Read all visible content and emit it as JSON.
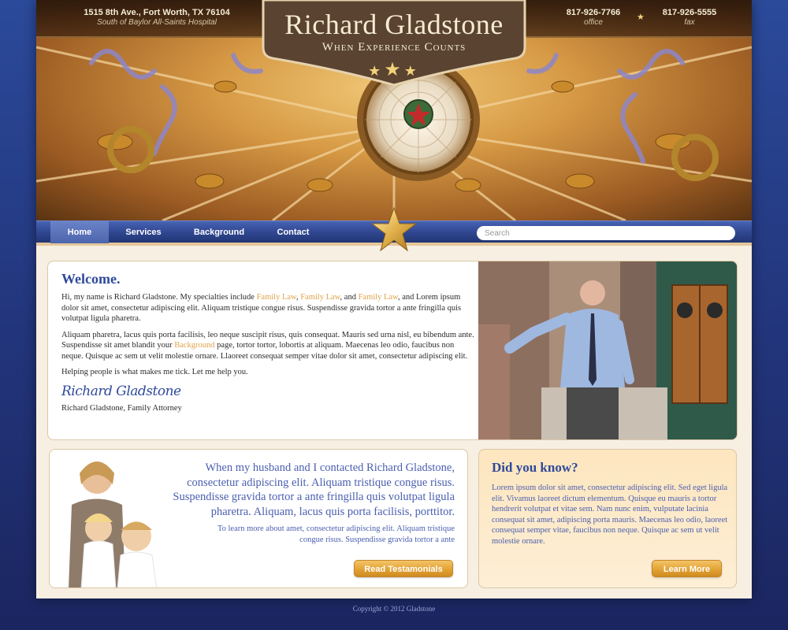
{
  "header": {
    "address_line1": "1515 8th Ave., Fort Worth, TX 76104",
    "address_line2": "South of Baylor All-Saints Hospital",
    "phone_office": "817-926-7766",
    "phone_office_label": "office",
    "phone_fax": "817-926-5555",
    "phone_fax_label": "fax",
    "logo_title": "Richard Gladstone",
    "logo_tagline": "When Experience Counts"
  },
  "nav": {
    "items": [
      {
        "label": "Home",
        "active": true
      },
      {
        "label": "Services",
        "active": false
      },
      {
        "label": "Background",
        "active": false
      },
      {
        "label": "Contact",
        "active": false
      }
    ],
    "search_placeholder": "Search"
  },
  "welcome": {
    "title": "Welcome.",
    "p1_before": "Hi, my name is Richard Gladstone. My specialties include ",
    "p1_link1": "Family Law",
    "p1_sep1": ", ",
    "p1_link2": "Family Law",
    "p1_sep2": ", and ",
    "p1_link3": "Family Law",
    "p1_after": ", and Lorem ipsum dolor sit amet, consectetur adipiscing elit. Aliquam tristique congue risus. Suspendisse gravida tortor a ante fringilla quis volutpat ligula pharetra.",
    "p2_before": "Aliquam pharetra, lacus quis porta facilisis, leo neque suscipit risus, quis consequat. Mauris sed urna nisl, eu bibendum ante. Suspendisse sit amet blandit your ",
    "p2_link": "Background",
    "p2_after": " page, tortor tortor, lobortis at aliquam. Maecenas leo odio, faucibus non neque. Quisque ac sem ut velit molestie ornare. Llaoreet consequat semper vitae dolor sit amet, consectetur adipiscing elit.",
    "p3": "Helping people is what makes me tick. Let me help you.",
    "signature": "Richard Gladstone",
    "signature_caption": "Richard Gladstone, Family Attorney"
  },
  "testimonial": {
    "quote": "When my husband and I contacted Richard Gladstone, consectetur adipiscing elit. Aliquam tristique congue risus. Suspendisse gravida tortor a ante fringilla quis volutpat ligula pharetra. Aliquam, lacus quis porta facilisis, porttitor.",
    "more": "To learn more about amet, consectetur adipiscing elit. Aliquam tristique congue risus. Suspendisse gravida tortor a ante",
    "button": "Read Testamonials"
  },
  "did_you_know": {
    "title": "Did you know?",
    "body": "Lorem ipsum dolor sit amet, consectetur adipiscing elit. Sed eget ligula elit. Vivamus laoreet dictum elementum. Quisque eu mauris a tortor hendrerit volutpat et vitae sem. Nam nunc enim, vulputate lacinia consequat sit amet, adipiscing porta mauris. Maecenas leo odio, laoreet consequat semper vitae, faucibus non neque. Quisque ac sem ut velit molestie ornare.",
    "button": "Learn More"
  },
  "footer": {
    "copyright": "Copyright © 2012 Gladstone"
  },
  "colors": {
    "brand_blue": "#2f4a9a",
    "accent_gold": "#e3a235",
    "link_orange": "#e0a24a"
  }
}
